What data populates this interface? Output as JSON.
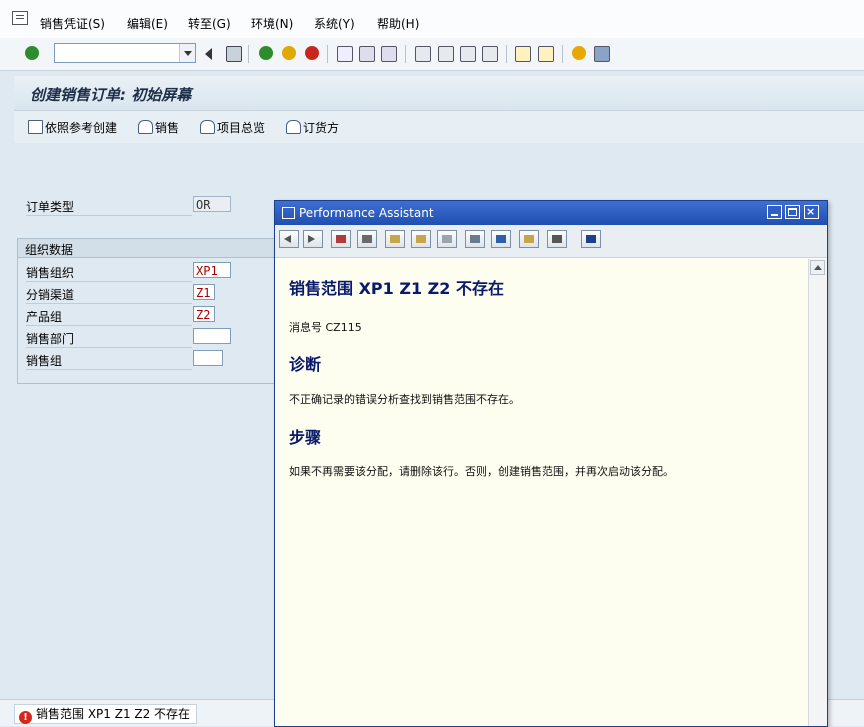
{
  "menu": {
    "items": [
      {
        "label": "销售凭证(S)"
      },
      {
        "label": "编辑(E)"
      },
      {
        "label": "转至(G)"
      },
      {
        "label": "环境(N)"
      },
      {
        "label": "系统(Y)"
      },
      {
        "label": "帮助(H)"
      }
    ]
  },
  "toolbar": {
    "command_value": ""
  },
  "page": {
    "title": "创建销售订单: 初始屏幕"
  },
  "app_toolbar": {
    "create_ref": "依照参考创建",
    "sales": "销售",
    "item_overview": "项目总览",
    "ordering_party": "订货方"
  },
  "form": {
    "order_type_label": "订单类型",
    "order_type_value": "OR",
    "org_group_title": "组织数据",
    "sales_org_label": "销售组织",
    "sales_org_value": "XP1",
    "distr_channel_label": "分销渠道",
    "distr_channel_value": "Z1",
    "division_label": "产品组",
    "division_value": "Z2",
    "sales_office_label": "销售部门",
    "sales_office_value": "",
    "sales_group_label": "销售组",
    "sales_group_value": ""
  },
  "status": {
    "message": "销售范围 XP1 Z1 Z2 不存在"
  },
  "popup": {
    "title": "Performance Assistant",
    "heading": "销售范围  XP1 Z1 Z2 不存在",
    "message_no": "消息号  CZ115",
    "diagnosis_heading": "诊断",
    "diagnosis_text": "不正确记录的错误分析查找到销售范围不存在。",
    "procedure_heading": "步骤",
    "procedure_text": "如果不再需要该分配，请删除该行。否则，创建销售范围，并再次启动该分配。"
  },
  "colors": {
    "popup_title": "#1f4fb0",
    "popup_content_bg": "#fefef0",
    "heading_text": "#0a1a6a",
    "error_red": "#d8261d"
  }
}
